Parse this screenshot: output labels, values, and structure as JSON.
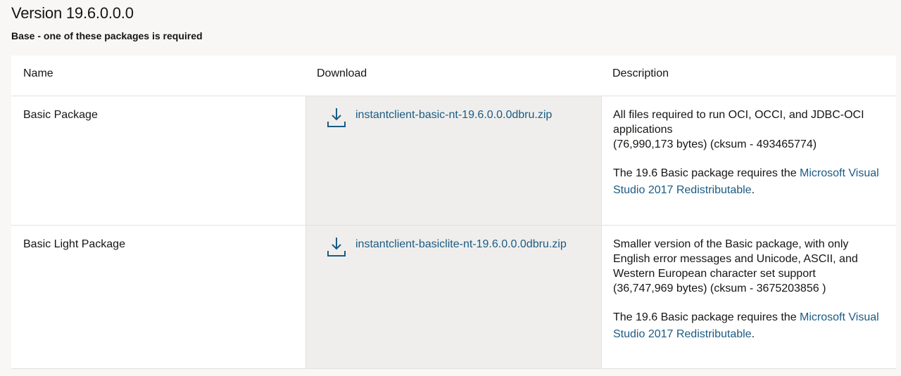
{
  "version_title": "Version 19.6.0.0.0",
  "subtitle": "Base - one of these packages is required",
  "table": {
    "headers": {
      "name": "Name",
      "download": "Download",
      "description": "Description"
    },
    "rows": [
      {
        "name": "Basic Package",
        "download_file": "instantclient-basic-nt-19.6.0.0.0dbru.zip",
        "description_lines": [
          "All files required to run OCI, OCCI, and JDBC-OCI",
          "applications",
          "(76,990,173 bytes) (cksum - 493465774)"
        ],
        "note_prefix": "The 19.6 Basic package requires the ",
        "note_link": "Microsoft Visual Studio 2017 Redistributable",
        "note_suffix": "."
      },
      {
        "name": "Basic Light Package",
        "download_file": "instantclient-basiclite-nt-19.6.0.0.0dbru.zip",
        "description_lines": [
          "Smaller version of the Basic package, with only",
          "English error messages and Unicode, ASCII, and",
          "Western European character set support",
          "(36,747,969 bytes) (cksum - 3675203856 )"
        ],
        "note_prefix": "The 19.6 Basic package requires the ",
        "note_link": "Microsoft Visual Studio 2017 Redistributable",
        "note_suffix": "."
      }
    ]
  },
  "colors": {
    "link": "#1a5b84",
    "download_column_bg": "#efeeec",
    "page_bg": "#f8f7f5"
  },
  "icons": {
    "download": "download-icon"
  }
}
